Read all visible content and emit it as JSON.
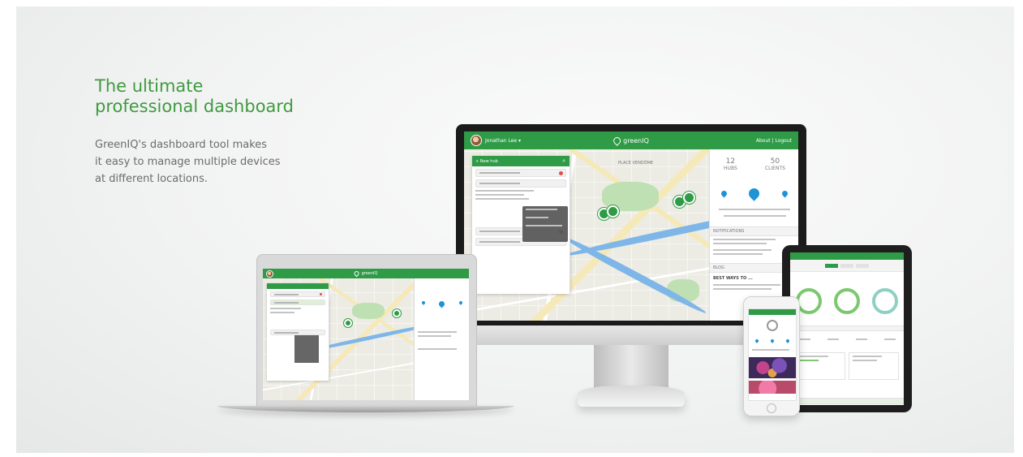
{
  "hero": {
    "title_line1": "The ultimate",
    "title_line2": "professional dashboard",
    "body_line1": "GreenIQ's dashboard tool makes",
    "body_line2": "it easy to manage multiple devices",
    "body_line3": "at different locations."
  },
  "colors": {
    "brand_green": "#2f9b46",
    "title_green": "#3f9a3f",
    "water_blue": "#1e93d6",
    "alert_red": "#e34b4b"
  },
  "dashboard": {
    "brand": "greenIQ",
    "user": "Jonathan Lee ▾",
    "account_link": "About | Logout",
    "new_hub": "+ New hub",
    "stats": {
      "hubs_count": "12",
      "hubs_label": "HUBS",
      "clients_count": "50",
      "clients_label": "CLIENTS"
    },
    "sections": {
      "notifications": "NOTIFICATIONS",
      "blog": "BLOG"
    },
    "map_labels": {
      "place_vendome": "PLACE VENDÔME"
    },
    "blog_headline": "BEST WAYS TO ..."
  },
  "icons": [
    "avatar-icon",
    "greeniq-logo-icon",
    "water-drop-icon",
    "map-pin-icon",
    "search-icon",
    "list-icon",
    "alert-dot-icon"
  ]
}
